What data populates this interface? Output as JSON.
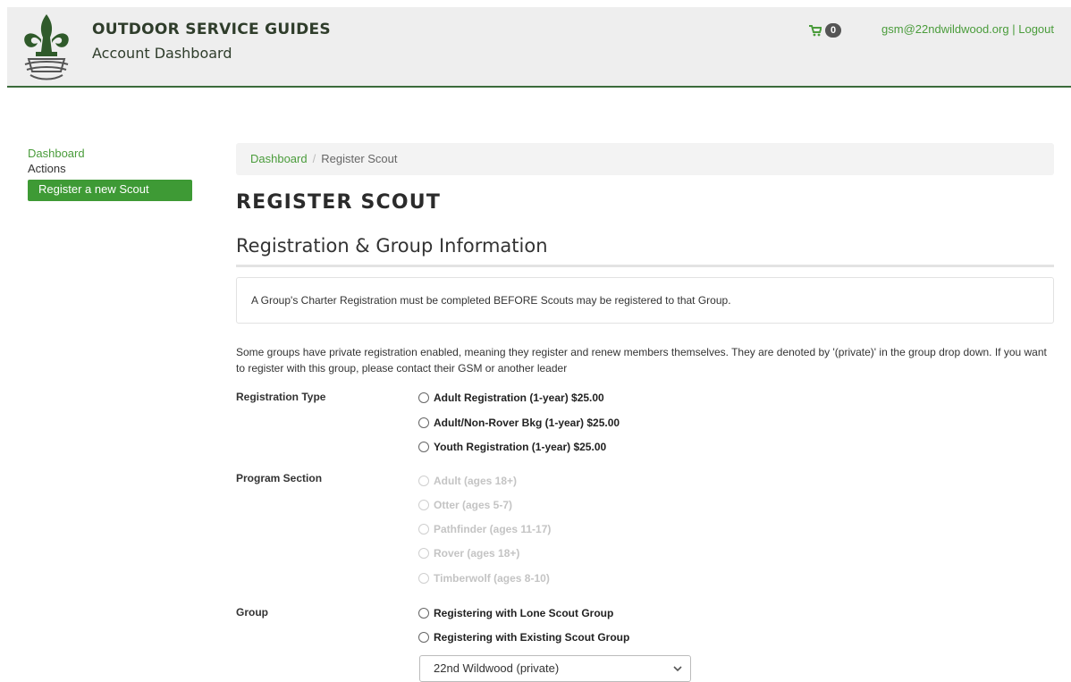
{
  "header": {
    "brand_title": "OUTDOOR SERVICE GUIDES",
    "brand_subtitle": "Account Dashboard",
    "cart_count": "0",
    "user_email": "gsm@22ndwildwood.org",
    "separator": "|",
    "logout_label": "Logout"
  },
  "sidebar": {
    "dashboard_label": "Dashboard",
    "actions_label": "Actions",
    "register_button_label": "Register a new Scout"
  },
  "breadcrumb": {
    "home": "Dashboard",
    "separator": "/",
    "current": "Register Scout"
  },
  "page": {
    "title": "REGISTER SCOUT",
    "section_title": "Registration & Group Information",
    "notice": "A Group's Charter Registration must be completed BEFORE Scouts may be registered to that Group.",
    "info": "Some groups have private registration enabled, meaning they register and renew members themselves. They are denoted by '(private)' in the group drop down. If you want to register with this group, please contact their GSM or another leader"
  },
  "form": {
    "registration_type": {
      "label": "Registration Type",
      "options": [
        "Adult Registration (1-year) $25.00",
        "Adult/Non-Rover Bkg (1-year) $25.00",
        "Youth Registration (1-year) $25.00"
      ]
    },
    "program_section": {
      "label": "Program Section",
      "options": [
        "Adult (ages 18+)",
        "Otter (ages 5-7)",
        "Pathfinder (ages 11-17)",
        "Rover (ages 18+)",
        "Timberwolf (ages 8-10)"
      ]
    },
    "group": {
      "label": "Group",
      "options": [
        "Registering with Lone Scout Group",
        "Registering with Existing Scout Group"
      ],
      "selected_group": "22nd Wildwood (private)"
    }
  },
  "colors": {
    "accent_green": "#4a9c3b",
    "button_green": "#3e9a35",
    "header_bg": "#eeeeee",
    "header_border": "#3b6b3b"
  },
  "icons": [
    "fleur-de-lis-logo-icon",
    "cart-icon",
    "chevron-down-icon"
  ]
}
